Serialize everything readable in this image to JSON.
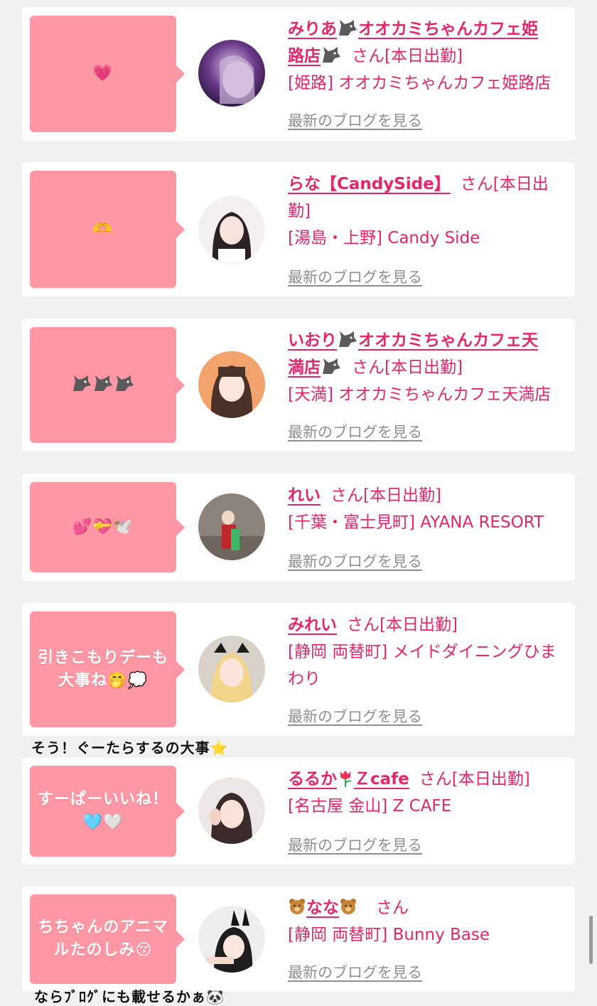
{
  "cards": [
    {
      "bubble": "💗",
      "name_parts": [
        "みりあ",
        "wolf",
        "オオカミちゃんカフェ姫路店",
        "wolf"
      ],
      "san": "さん[本日出勤]",
      "shop": "[姫路] オオカミちゃんカフェ姫路店",
      "blog": "最新のブログを見る"
    },
    {
      "bubble": "🫶",
      "name_parts": [
        "らな【CandySide】"
      ],
      "san": "さん[本日出勤]",
      "shop": "[湯島・上野] Candy Side",
      "blog": "最新のブログを見る"
    },
    {
      "bubble": "wolf wolf wolf",
      "name_parts": [
        "いおり",
        "wolf",
        "オオカミちゃんカフェ天満店",
        "wolf"
      ],
      "san": "さん[本日出勤]",
      "shop": "[天満] オオカミちゃんカフェ天満店",
      "blog": "最新のブログを見る"
    },
    {
      "bubble": "💕💝🕊️",
      "name_parts": [
        "れい"
      ],
      "san": "さん[本日出勤]",
      "shop": "[千葉・富士見町] AYANA RESORT",
      "blog": "最新のブログを見る"
    },
    {
      "bubble": "引きこもりデーも大事ね🤭💭",
      "name_parts": [
        "みれい"
      ],
      "san": "さん[本日出勤]",
      "shop": "[静岡 両替町] メイドダイニングひまわり",
      "blog": "最新のブログを見る"
    },
    {
      "bubble": "すーぱーいいね！🩵🤍",
      "name_parts": [
        "るるか",
        "tulip",
        "Ｚcafe"
      ],
      "san": "さん[本日出勤]",
      "shop": "[名古屋 金山] Z CAFE",
      "blog": "最新のブログを見る"
    },
    {
      "bubble": "ちちゃんのアニマルたのしみ😚",
      "name_parts": [
        "bear",
        "なな",
        "bear"
      ],
      "san": "さん",
      "shop": "[静岡 両替町] Bunny Base",
      "blog": "最新のブログを見る"
    }
  ],
  "notes": {
    "after_card_5": "そう！ぐーたらするの大事⭐️",
    "after_card_7": "ならﾌﾞﾛｸﾞにも載せるかぁ🐼"
  },
  "bubble_lines": {
    "b5": [
      "引きこもりデーも",
      "大事ね🤭💭"
    ],
    "b6": [
      "すーぱーいいね！",
      "🩵🤍"
    ],
    "b7": [
      "ちちゃんのアニマ",
      "ルたのしみ😚"
    ]
  },
  "name_text": {
    "c1a": "みりあ",
    "c1b": "オオカミちゃんカフェ姫",
    "c1c": "路店",
    "c2": "らな【CandySide】",
    "c3a": "いおり",
    "c3b": "オオカミちゃんカフェ天",
    "c3c": "満店",
    "c4": "れい",
    "c5": "みれい",
    "c6a": "るるか",
    "c6b": "Ｚcafe",
    "c7": "なな"
  },
  "colors": {
    "accent": "#e5266d",
    "bubble": "#ff97a5",
    "link_gray": "#8f8f8f",
    "background": "#f1f1f1"
  },
  "icons": [
    "wolf-icon",
    "bear-icon",
    "tulip-icon"
  ]
}
